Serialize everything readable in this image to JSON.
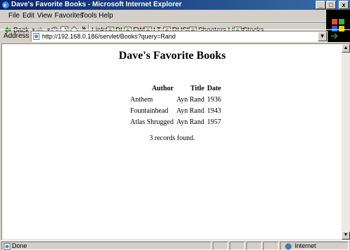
{
  "window": {
    "title": "Dave's Favorite Books - Microsoft Internet Explorer",
    "minimize": "_",
    "maximize": "□",
    "close": "x"
  },
  "menu": [
    "File",
    "Edit",
    "View",
    "Favorites",
    "Tools",
    "Help"
  ],
  "toolbar": {
    "back_label": "Back",
    "more": "»",
    "links_label": "Links",
    "links": [
      "DH",
      "FW",
      "LT",
      "RUSH",
      "Shooters Links",
      "Stocks"
    ]
  },
  "address": {
    "label": "Address",
    "url": "http://192.168.0.186/servlet/Books?query=Rand",
    "go_label": "Go"
  },
  "page": {
    "title": "Dave's Favorite Books",
    "columns": [
      "Author",
      "Title",
      "Date"
    ],
    "rows": [
      [
        "Anthem",
        "Ayn Rand",
        "1936"
      ],
      [
        "Fountainhead",
        "Ayn Rand",
        "1943"
      ],
      [
        "Atlas Shrugged",
        "Ayn Rand",
        "1957"
      ]
    ],
    "records_text": "3 records found."
  },
  "status": {
    "text": "Done",
    "zone": "Internet"
  },
  "icons": {
    "ie": "internet-explorer-icon",
    "back": "back-arrow-icon",
    "forward": "forward-arrow-icon",
    "stop": "stop-icon",
    "refresh": "refresh-icon",
    "home": "home-icon",
    "page": "page-icon",
    "go": "go-arrow-icon",
    "globe": "globe-icon"
  }
}
